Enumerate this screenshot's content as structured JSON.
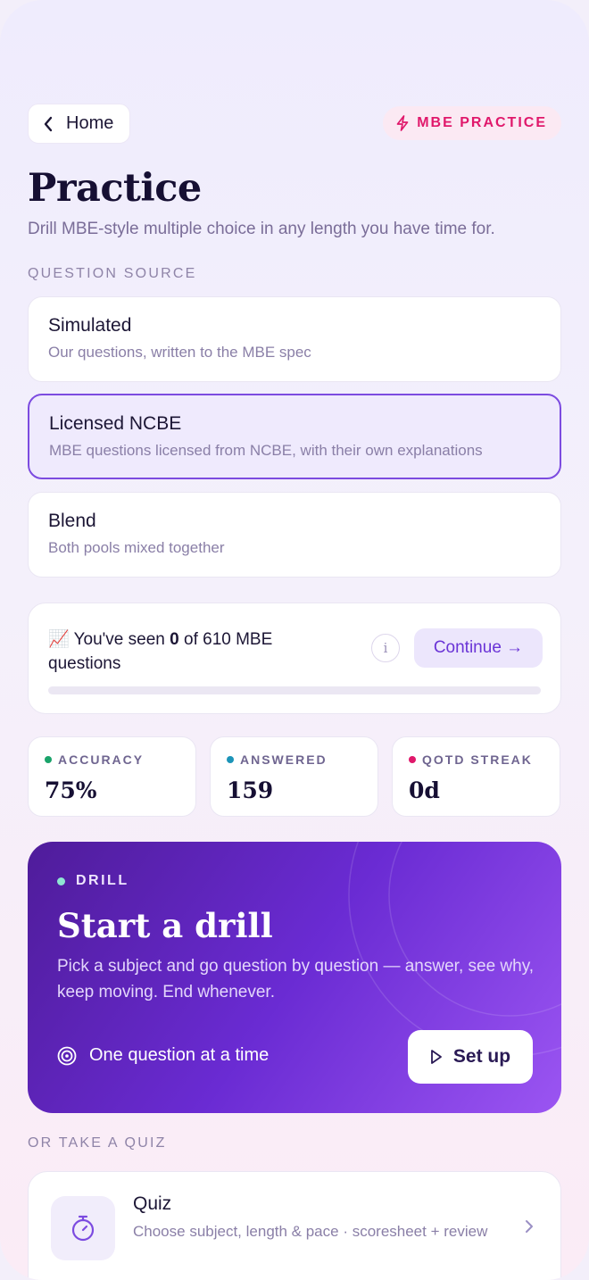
{
  "header": {
    "back_label": "Home",
    "chip_label": "MBE PRACTICE"
  },
  "page": {
    "title": "Practice",
    "subtitle": "Drill MBE-style multiple choice in any length you have time for."
  },
  "question_source": {
    "section_label": "QUESTION SOURCE",
    "selected": "Licensed NCBE",
    "options": [
      {
        "title": "Simulated",
        "desc": "Our questions, written to the MBE spec"
      },
      {
        "title": "Licensed NCBE",
        "desc": "MBE questions licensed from NCBE, with their own explanations"
      },
      {
        "title": "Blend",
        "desc": "Both pools mixed together"
      }
    ]
  },
  "progress": {
    "emoji": "📈",
    "prefix": "You've seen",
    "seen": "0",
    "middle": "of 610 MBE",
    "suffix": "questions",
    "info_label": "i",
    "continue_label": "Continue →",
    "fraction": 0
  },
  "stats": [
    {
      "label": "ACCURACY",
      "value": "75%",
      "color": "#1aa36a"
    },
    {
      "label": "ANSWERED",
      "value": "159",
      "color": "#1c94b8"
    },
    {
      "label": "QOTD STREAK",
      "value": "0d",
      "color": "#e0186b"
    }
  ],
  "drill": {
    "tag": "DRILL",
    "title": "Start a drill",
    "desc": "Pick a subject and go question by question — answer, see why, keep moving. End whenever.",
    "footer_label": "One question at a time",
    "button_label": "Set up"
  },
  "quiz_section": {
    "section_label": "OR TAKE A QUIZ",
    "title": "Quiz",
    "desc": "Choose subject, length & pace · scoresheet + review"
  },
  "colors": {
    "accent": "#7c4be0",
    "chip": "#e0186b"
  },
  "icons": [
    "chevron-left-icon",
    "lightning-icon",
    "info-icon",
    "target-icon",
    "play-icon",
    "stopwatch-icon",
    "chevron-right-icon"
  ]
}
